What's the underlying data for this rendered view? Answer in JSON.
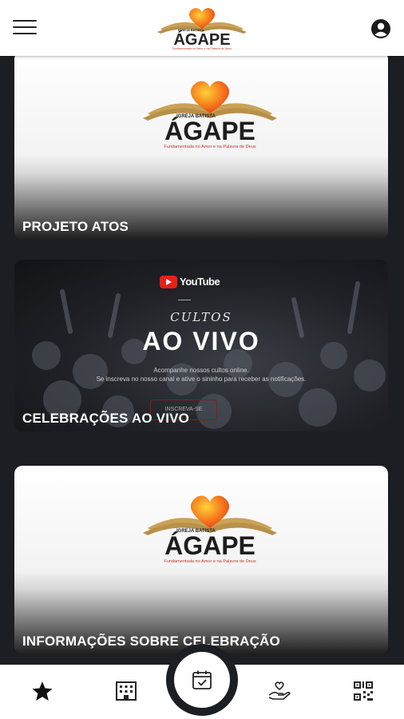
{
  "header": {
    "menu_icon": "hamburger-menu-icon",
    "account_icon": "account-circle-icon",
    "logo": {
      "small_text": "IGREJA BATISTA",
      "name": "ÁGAPE",
      "tagline": "Fundamentada no Amor e na Palavra de Deus"
    }
  },
  "cards": [
    {
      "title": "PROJETO ATOS",
      "logo": {
        "small_text": "IGREJA BATISTA",
        "name": "ÁGAPE",
        "tagline": "Fundamentada no Amor e na Palavra de Deus"
      }
    },
    {
      "title": "CELEBRAÇÕES AO VIVO",
      "youtube_label": "YouTube",
      "script_title": "CULTOS",
      "headline": "AO VIVO",
      "subtitle_line1": "Acompanhe nossos cultos online.",
      "subtitle_line2": "Se inscreva no nosso canal e ative o sininho para receber as notificações.",
      "button_label": "INSCREVA-SE"
    },
    {
      "title": "INFORMAÇÕES SOBRE CELEBRAÇÃO",
      "logo": {
        "small_text": "IGREJA BATISTA",
        "name": "ÁGAPE",
        "tagline": "Fundamentada no Amor e na Palavra de Deus"
      }
    }
  ],
  "bottom_nav": [
    {
      "icon": "star-icon"
    },
    {
      "icon": "building-icon"
    },
    {
      "icon": "calendar-check-icon"
    },
    {
      "icon": "hand-heart-icon"
    },
    {
      "icon": "qr-code-icon"
    }
  ],
  "colors": {
    "background": "#1b1e23",
    "heart_orange": "#f06a1a",
    "book_gold": "#c9a255",
    "tagline_red": "#c0392b"
  }
}
